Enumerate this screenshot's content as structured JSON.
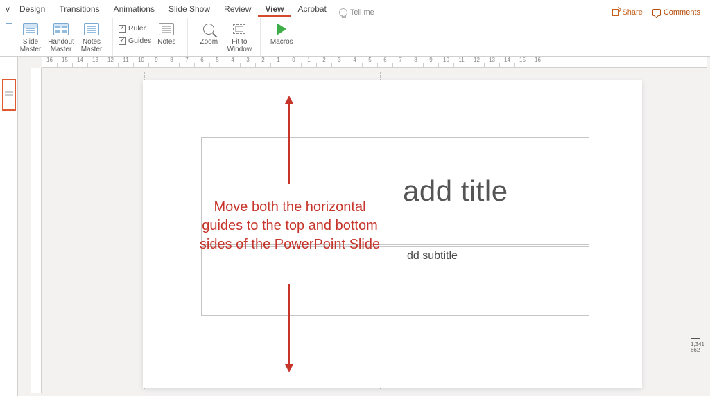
{
  "tabs": {
    "cut": "v",
    "design": "Design",
    "transitions": "Transitions",
    "animations": "Animations",
    "slideshow": "Slide Show",
    "review": "Review",
    "view": "View",
    "acrobat": "Acrobat",
    "tellme": "Tell me",
    "share": "Share",
    "comments": "Comments"
  },
  "ribbon": {
    "slide_master": "Slide\nMaster",
    "handout_master": "Handout\nMaster",
    "notes_master": "Notes\nMaster",
    "ruler": "Ruler",
    "guides": "Guides",
    "notes": "Notes",
    "zoom": "Zoom",
    "fit": "Fit to\nWindow",
    "macros": "Macros",
    "ruler_checked": "✓",
    "guides_checked": "✓"
  },
  "ruler_labels": [
    "16",
    "15",
    "14",
    "13",
    "12",
    "11",
    "10",
    "9",
    "8",
    "7",
    "6",
    "5",
    "4",
    "3",
    "2",
    "1",
    "0",
    "1",
    "2",
    "3",
    "4",
    "5",
    "6",
    "7",
    "8",
    "9",
    "10",
    "11",
    "12",
    "13",
    "14",
    "15",
    "16"
  ],
  "slide": {
    "title_placeholder": "add title",
    "subtitle_placeholder": "dd subtitle"
  },
  "annotation": {
    "text": "Move both the horizontal guides to the top and bottom sides of the PowerPoint Slide"
  },
  "cursor": {
    "x": "1,341",
    "y": "662"
  }
}
